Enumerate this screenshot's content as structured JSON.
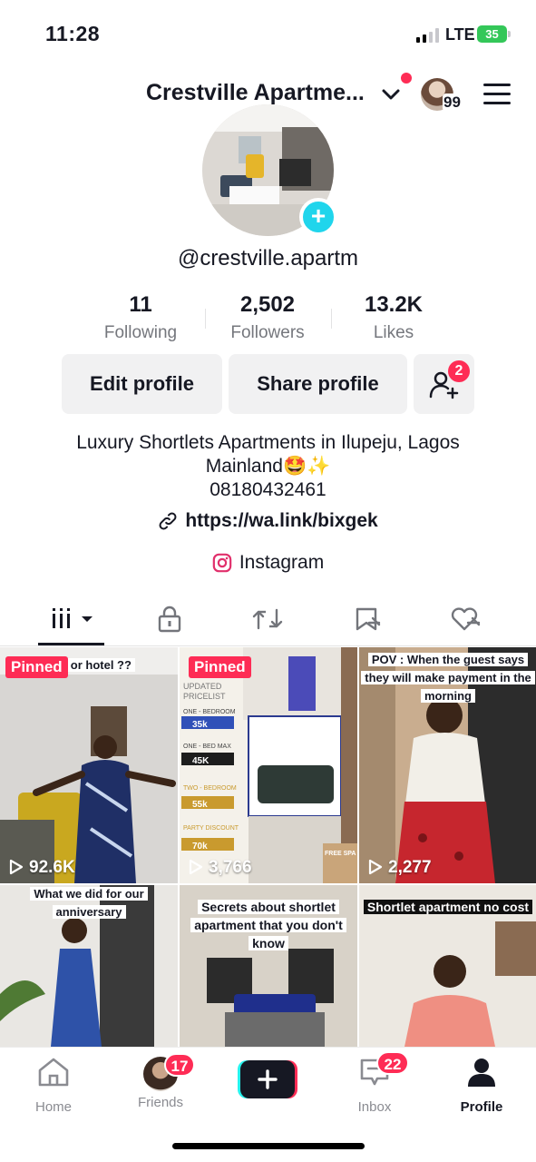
{
  "status_bar": {
    "time": "11:28",
    "network": "LTE",
    "battery": "35"
  },
  "header": {
    "account_name": "Crestville Apartme...",
    "account_count": "99"
  },
  "profile": {
    "handle": "@crestville.apartm",
    "stats": [
      {
        "value": "11",
        "label": "Following"
      },
      {
        "value": "2,502",
        "label": "Followers"
      },
      {
        "value": "13.2K",
        "label": "Likes"
      }
    ],
    "edit_button": "Edit profile",
    "share_button": "Share profile",
    "friend_requests": "2",
    "bio_line1": "Luxury Shortlets Apartments in Ilupeju, Lagos",
    "bio_line2": "Mainland🤩✨",
    "bio_line3": "08180432461",
    "link": "https://wa.link/bixgek",
    "instagram": "Instagram"
  },
  "tabs": [
    "videos",
    "private",
    "reposts",
    "favorites",
    "liked"
  ],
  "videos": [
    {
      "pinned": "Pinned",
      "caption": "dlet or hotel ??",
      "views": "92.6K"
    },
    {
      "pinned": "Pinned",
      "caption": "UPDATED PRICELIST",
      "views": "3,766"
    },
    {
      "pinned": "",
      "caption": "POV : When the guest says they will make payment in the morning",
      "views": "2,277"
    },
    {
      "pinned": "",
      "caption": "What we did for our anniversary",
      "views": ""
    },
    {
      "pinned": "",
      "caption": "Secrets about shortlet apartment that you don't know",
      "views": ""
    },
    {
      "pinned": "",
      "caption": "Shortlet apartment no cost",
      "views": ""
    }
  ],
  "pricelist": {
    "rows": [
      {
        "label": "ONE - BEDROOM",
        "price": "35k"
      },
      {
        "label": "ONE - BED MAX",
        "price": "45K"
      },
      {
        "label": "TWO - BEDROOM",
        "price": "55k"
      },
      {
        "label": "PARTY DISCOUNT",
        "price": "70k"
      }
    ],
    "badge": "FREE SPA"
  },
  "nav": {
    "home": "Home",
    "friends": "Friends",
    "friends_badge": "17",
    "inbox": "Inbox",
    "inbox_badge": "22",
    "profile": "Profile"
  },
  "colors": {
    "accent": "#fe2c55",
    "cyan": "#20d5ec",
    "text": "#161823",
    "muted": "#75777d"
  }
}
